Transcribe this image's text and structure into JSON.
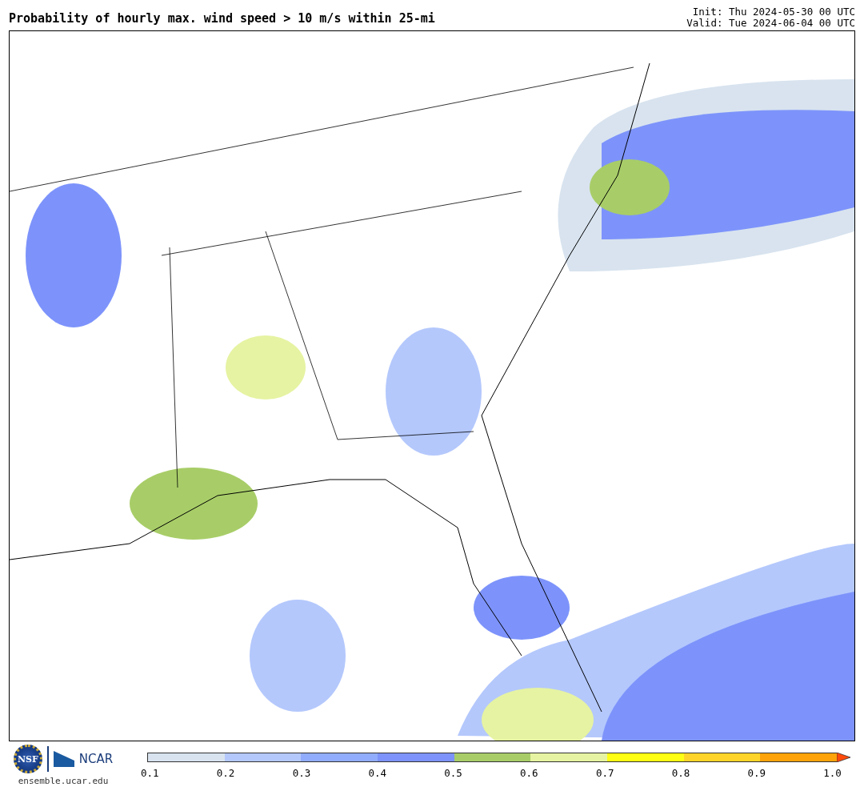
{
  "title": "Probability of hourly max. wind speed > 10 m/s within 25-mi",
  "init": "Init: Thu 2024-05-30 00 UTC",
  "valid": "Valid: Tue 2024-06-04 00 UTC",
  "logos": {
    "nsf": "NSF",
    "ncar": "NCAR",
    "site": "ensemble.ucar.edu"
  },
  "colorbar": {
    "bins": [
      {
        "color": "#d8e3ef"
      },
      {
        "color": "#b4c8fc"
      },
      {
        "color": "#91acfc"
      },
      {
        "color": "#7d93fb"
      },
      {
        "color": "#a8cd68"
      },
      {
        "color": "#e6f3a2"
      },
      {
        "color": "#ffff13"
      },
      {
        "color": "#ffd42a"
      },
      {
        "color": "#ffa30a"
      }
    ],
    "extension": {
      "color": "#ff4a0a"
    },
    "ticks": [
      "0.1",
      "0.2",
      "0.3",
      "0.4",
      "0.5",
      "0.6",
      "0.7",
      "0.8",
      "0.9",
      "1.0"
    ]
  }
}
